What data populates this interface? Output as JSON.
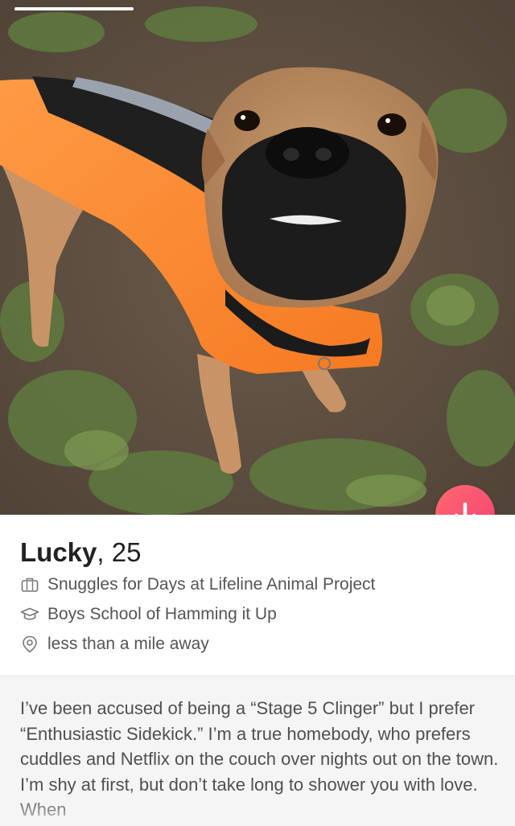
{
  "photo": {
    "description_icon": "dog-photo",
    "progress_color": "#ffffff"
  },
  "actions": {
    "collapse_icon": "arrow-down-icon",
    "button_color": "#f8487a"
  },
  "profile": {
    "name": "Lucky",
    "age_separator": ", ",
    "age": "25",
    "details": [
      {
        "icon": "briefcase-icon",
        "text": "Snuggles for Days at Lifeline Animal Project"
      },
      {
        "icon": "graduation-cap-icon",
        "text": "Boys School of Hamming it Up"
      },
      {
        "icon": "location-pin-icon",
        "text": "less than a mile away"
      }
    ]
  },
  "bio": {
    "text": "I’ve been accused of being a “Stage 5 Clinger” but I prefer “Enthusiastic Sidekick.” I’m a true homebody, who prefers cuddles and Netflix on the couch over nights out on the town. I’m shy at first, but don’t take long to shower you with love. When"
  }
}
